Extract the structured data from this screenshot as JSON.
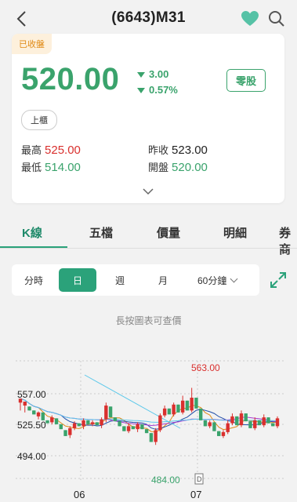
{
  "header": {
    "title": "(6643)M31"
  },
  "quote": {
    "status_badge": "已收盤",
    "price": "520.00",
    "change": "3.00",
    "change_pct": "0.57%",
    "odd_lot_button": "零股",
    "market_tag": "上櫃",
    "stats": {
      "high_label": "最高",
      "high_value": "525.00",
      "low_label": "最低",
      "low_value": "514.00",
      "prev_close_label": "昨收",
      "prev_close_value": "523.00",
      "open_label": "開盤",
      "open_value": "520.00"
    }
  },
  "tabs": [
    "K線",
    "五檔",
    "價量",
    "明細",
    "券商"
  ],
  "period_bar": {
    "items": [
      "分時",
      "日",
      "週",
      "月",
      "60分鐘"
    ],
    "selected": "日"
  },
  "hint": "長按圖表可查價",
  "chart_data": {
    "type": "candlestick",
    "y_ticks": [
      "557.00",
      "525.50",
      "494.00"
    ],
    "x_ticks": [
      "06",
      "07"
    ],
    "max_label": "563.00",
    "min_label": "484.00",
    "marker": "D",
    "candles": [
      [
        548,
        552,
        540,
        553,
        539
      ],
      [
        545,
        549,
        538,
        550,
        536
      ],
      [
        544,
        540,
        545,
        537
      ],
      [
        540,
        536,
        541,
        533
      ],
      [
        534,
        538,
        531,
        539
      ],
      [
        538,
        530,
        539,
        528
      ],
      [
        530,
        527,
        532,
        525
      ],
      [
        528,
        533,
        526,
        535
      ],
      [
        532,
        526,
        534,
        524
      ],
      [
        526,
        521,
        528,
        518
      ],
      [
        520,
        514,
        522,
        510
      ],
      [
        515,
        522,
        512,
        524
      ],
      [
        522,
        527,
        520,
        529
      ],
      [
        527,
        524,
        529,
        522
      ],
      [
        524,
        530,
        521,
        532
      ],
      [
        530,
        526,
        532,
        524
      ],
      [
        526,
        528,
        524,
        530
      ],
      [
        528,
        525,
        531,
        523
      ],
      [
        525,
        531,
        522,
        533
      ],
      [
        531,
        545,
        528,
        548
      ],
      [
        544,
        533,
        546,
        531
      ],
      [
        533,
        529,
        536,
        527
      ],
      [
        529,
        524,
        531,
        522
      ],
      [
        524,
        519,
        526,
        516
      ],
      [
        519,
        524,
        517,
        527
      ],
      [
        524,
        521,
        527,
        519
      ],
      [
        521,
        526,
        518,
        528
      ],
      [
        526,
        521,
        529,
        519
      ],
      [
        521,
        517,
        523,
        514
      ],
      [
        517,
        508,
        519,
        505
      ],
      [
        508,
        520,
        505,
        522
      ],
      [
        520,
        535,
        518,
        537
      ],
      [
        535,
        542,
        533,
        545
      ],
      [
        542,
        536,
        544,
        534
      ],
      [
        536,
        546,
        534,
        548
      ],
      [
        546,
        538,
        548,
        536
      ],
      [
        538,
        550,
        536,
        555
      ],
      [
        550,
        540,
        552,
        530
      ],
      [
        540,
        553,
        538,
        563
      ],
      [
        553,
        542,
        555,
        540
      ],
      [
        542,
        530,
        544,
        527
      ],
      [
        530,
        524,
        532,
        520
      ],
      [
        524,
        528,
        522,
        530
      ],
      [
        528,
        519,
        530,
        516
      ],
      [
        519,
        514,
        521,
        510
      ],
      [
        514,
        518,
        512,
        520
      ],
      [
        518,
        527,
        516,
        530
      ],
      [
        527,
        534,
        525,
        537
      ],
      [
        534,
        525,
        536,
        522
      ],
      [
        525,
        537,
        523,
        540
      ],
      [
        537,
        529,
        539,
        527
      ],
      [
        529,
        522,
        531,
        520
      ],
      [
        522,
        530,
        520,
        533
      ],
      [
        530,
        525,
        532,
        523
      ],
      [
        525,
        533,
        523,
        536
      ],
      [
        533,
        527,
        535,
        525
      ],
      [
        527,
        524,
        529,
        522
      ],
      [
        524,
        532,
        522,
        534
      ]
    ]
  },
  "colors": {
    "up": "#d9302e",
    "down": "#3aa36c",
    "accent": "#2ba27a"
  }
}
